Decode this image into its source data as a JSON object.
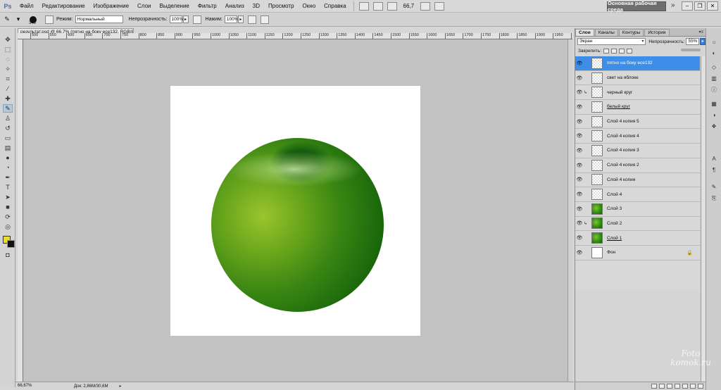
{
  "app": {
    "logo": "Ps"
  },
  "menubar": {
    "items": [
      "Файл",
      "Редактирование",
      "Изображение",
      "Слои",
      "Выделение",
      "Фильтр",
      "Анализ",
      "3D",
      "Просмотр",
      "Окно",
      "Справка"
    ],
    "zoom": "66,7",
    "workspace": "Основная рабочая среда",
    "more": "»"
  },
  "options": {
    "brush_size": "349",
    "mode_label": "Режим:",
    "mode_value": "Нормальный",
    "opacity_label": "Непрозрачность:",
    "opacity_value": "100%",
    "pressure_label": "Нажим:",
    "pressure_value": "100%"
  },
  "document": {
    "tab_title": "результат.psd @ 66,7% (пятно на боку есе132, RGB/8)",
    "ruler_ticks": [
      "500",
      "550",
      "600",
      "650",
      "700",
      "750",
      "800",
      "850",
      "900",
      "950",
      "1000",
      "1050",
      "1100",
      "1150",
      "1200",
      "1250",
      "1300",
      "1350",
      "1400",
      "1450",
      "1500",
      "1550",
      "1600",
      "1650",
      "1700",
      "1750",
      "1800",
      "1850",
      "1900",
      "1950",
      "2000"
    ]
  },
  "status": {
    "zoom": "66,67%",
    "doc_size": "Док: 2,86M/30,6M",
    "arrow": "▸"
  },
  "layers_panel": {
    "tabs": [
      "Слои",
      "Каналы",
      "Контуры",
      "История"
    ],
    "blend_mode": "Экран",
    "opacity_label": "Непрозрачность:",
    "opacity_value": "55%",
    "lock_label": "Закрепить:",
    "layers": [
      {
        "name": "пятно на боку есе132",
        "thumb": "transparent",
        "selected": true
      },
      {
        "name": "свет на яблоке",
        "thumb": "transparent"
      },
      {
        "name": "черный круг",
        "thumb": "transparent",
        "clipped": true
      },
      {
        "name": "белый круг",
        "thumb": "transparent",
        "underlined": true
      },
      {
        "name": "Слой 4 копия 5",
        "thumb": "transparent"
      },
      {
        "name": "Слой 4 копия 4",
        "thumb": "transparent"
      },
      {
        "name": "Слой 4 копия 3",
        "thumb": "transparent"
      },
      {
        "name": "Слой 4 копия 2",
        "thumb": "transparent"
      },
      {
        "name": "Слой 4 копия",
        "thumb": "transparent"
      },
      {
        "name": "Слой 4",
        "thumb": "transparent"
      },
      {
        "name": "Слой 3",
        "thumb": "green"
      },
      {
        "name": "Слой 2",
        "thumb": "green",
        "clipped": true
      },
      {
        "name": "Слой 1",
        "thumb": "green",
        "underlined": true
      },
      {
        "name": "Фон",
        "thumb": "white",
        "locked": true
      }
    ]
  },
  "colors": {
    "foreground": "#e9df2a",
    "background": "#111111",
    "selection": "#3d8ee9",
    "apple_light": "#9ac52d",
    "apple_dark": "#0d4a06"
  },
  "watermark": {
    "line1": "Foto",
    "line2": "komok.ru"
  }
}
